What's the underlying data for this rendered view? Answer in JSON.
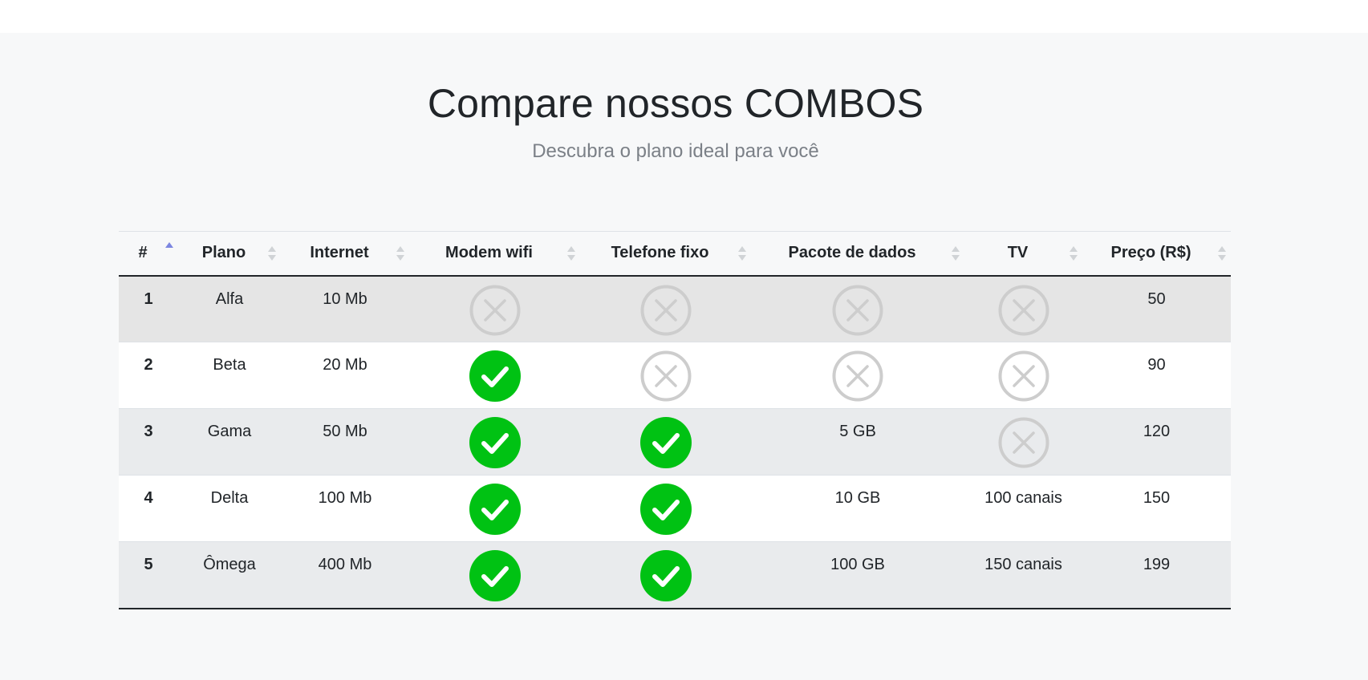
{
  "header": {
    "title": "Compare nossos COMBOS",
    "subtitle": "Descubra o plano ideal para você"
  },
  "table": {
    "columns": [
      "#",
      "Plano",
      "Internet",
      "Modem wifi",
      "Telefone fixo",
      "Pacote de dados",
      "TV",
      "Preço (R$)"
    ],
    "sorted_column": "#",
    "rows": [
      {
        "num": "1",
        "plano": "Alfa",
        "internet": "10 Mb",
        "modem": {
          "icon": "x-circle-icon"
        },
        "telefone": {
          "icon": "x-circle-icon"
        },
        "dados": {
          "icon": "x-circle-icon"
        },
        "tv": {
          "icon": "x-circle-icon"
        },
        "preco": "50"
      },
      {
        "num": "2",
        "plano": "Beta",
        "internet": "20 Mb",
        "modem": {
          "icon": "check-circle-icon"
        },
        "telefone": {
          "icon": "x-circle-icon"
        },
        "dados": {
          "icon": "x-circle-icon"
        },
        "tv": {
          "icon": "x-circle-icon"
        },
        "preco": "90"
      },
      {
        "num": "3",
        "plano": "Gama",
        "internet": "50 Mb",
        "modem": {
          "icon": "check-circle-icon"
        },
        "telefone": {
          "icon": "check-circle-icon"
        },
        "dados": {
          "text": "5 GB"
        },
        "tv": {
          "icon": "x-circle-icon"
        },
        "preco": "120"
      },
      {
        "num": "4",
        "plano": "Delta",
        "internet": "100 Mb",
        "modem": {
          "icon": "check-circle-icon"
        },
        "telefone": {
          "icon": "check-circle-icon"
        },
        "dados": {
          "text": "10 GB"
        },
        "tv": {
          "text": "100 canais"
        },
        "preco": "150"
      },
      {
        "num": "5",
        "plano": "Ômega",
        "internet": "400 Mb",
        "modem": {
          "icon": "check-circle-icon"
        },
        "telefone": {
          "icon": "check-circle-icon"
        },
        "dados": {
          "text": "100 GB"
        },
        "tv": {
          "text": "150 canais"
        },
        "preco": "199"
      }
    ]
  },
  "colors": {
    "check": "#00c213",
    "x": "#cdcdcd",
    "sort_active": "#7c86e0"
  }
}
